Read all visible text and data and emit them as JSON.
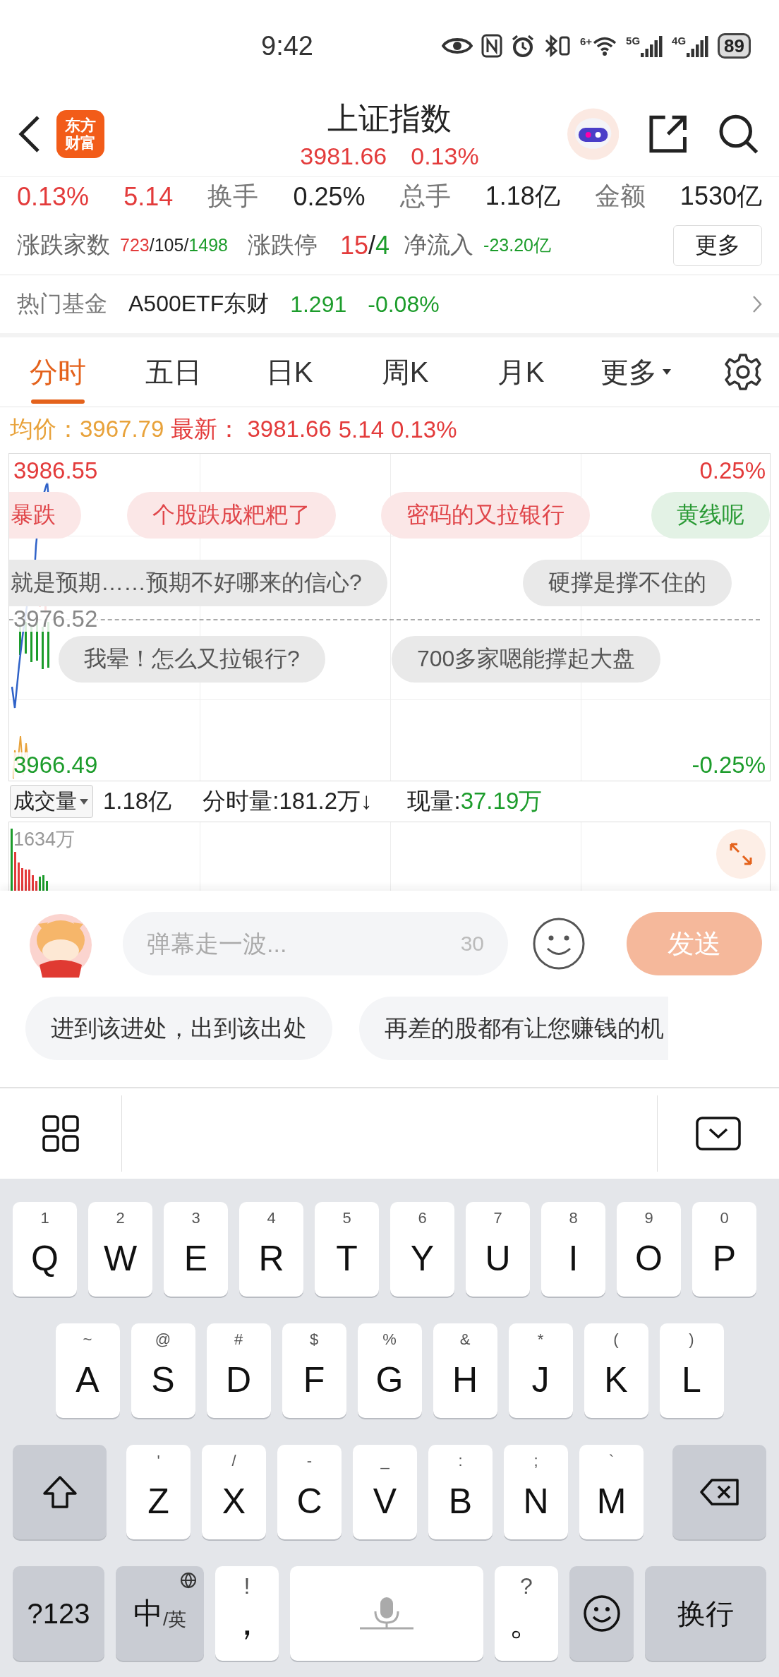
{
  "status_bar": {
    "time": "9:42",
    "wifi_label": "6+",
    "networks": [
      "5G",
      "4G"
    ],
    "battery": "89"
  },
  "header": {
    "logo": [
      "东方",
      "财富"
    ],
    "title": "上证指数",
    "price": "3981.66",
    "change_pct": "0.13%"
  },
  "stats": [
    {
      "kind": "up",
      "text": "0.13%"
    },
    {
      "kind": "up",
      "text": "5.14"
    },
    {
      "kind": "label",
      "text": "换手"
    },
    {
      "kind": "value",
      "text": "0.25%"
    },
    {
      "kind": "label",
      "text": "总手"
    },
    {
      "kind": "value",
      "text": "1.18亿"
    },
    {
      "kind": "label",
      "text": "金额"
    },
    {
      "kind": "value",
      "text": "1530亿"
    }
  ],
  "breadth": {
    "label": "涨跌家数",
    "up": "723",
    "flat": "105",
    "down": "1498",
    "separator": "/"
  },
  "limits": {
    "label": "涨跌停",
    "up": "15",
    "down": "4",
    "separator": "/"
  },
  "net_inflow": {
    "label": "净流入",
    "value": "-23.20亿"
  },
  "more_button": "更多",
  "hot_fund": {
    "label": "热门基金",
    "name": "A500ETF东财",
    "price": "1.291",
    "change": "-0.08%"
  },
  "tabs": [
    {
      "label": "分时",
      "selected": true,
      "kind": "tab"
    },
    {
      "label": "五日",
      "selected": false,
      "kind": "tab"
    },
    {
      "label": "日K",
      "selected": false,
      "kind": "tab"
    },
    {
      "label": "周K",
      "selected": false,
      "kind": "tab"
    },
    {
      "label": "月K",
      "selected": false,
      "kind": "tab"
    },
    {
      "label": "更多",
      "selected": false,
      "kind": "menu"
    }
  ],
  "quote_line": {
    "avg_label": "均价：",
    "avg": "3967.79",
    "latest_label": "最新：",
    "latest": "3981.66",
    "change": "5.14",
    "change_pct": "0.13%"
  },
  "chart": {
    "high": "3986.55",
    "high_pct": "0.25%",
    "mid": "3976.52",
    "low": "3966.49",
    "low_pct": "-0.25%",
    "danmaku": [
      [
        {
          "text": "暴跌",
          "color": "#e0464a"
        },
        {
          "text": "个股跌成粑粑了",
          "color": "#e0464a"
        },
        {
          "text": "密码的又拉银行",
          "color": "#e0464a"
        },
        {
          "text": "黄线呢",
          "color": "#2a9a35"
        }
      ],
      [
        {
          "text": "就是预期……预期不好哪来的信心?",
          "color": "#555555"
        },
        {
          "text": "硬撑是撑不住的",
          "color": "#555555"
        }
      ],
      [
        {
          "text": "我晕！怎么又拉银行?",
          "color": "#555555"
        },
        {
          "text": "700多家嗯能撑起大盘",
          "color": "#555555"
        }
      ]
    ]
  },
  "volume": {
    "selector": "成交量",
    "total": "1.18亿",
    "period": "分时量:181.2万↓",
    "current_label": "现量:",
    "current": "37.19万",
    "max": "1634万"
  },
  "comment": {
    "placeholder": "弹幕走一波...",
    "counter": "30",
    "send": "发送",
    "quick_phrases": [
      "进到该进处，出到该出处",
      "再差的股都有让您赚钱的机"
    ]
  },
  "keyboard": [
    [
      {
        "kind": "char",
        "label": "Q",
        "hint": "1"
      },
      {
        "kind": "char",
        "label": "W",
        "hint": "2"
      },
      {
        "kind": "char",
        "label": "E",
        "hint": "3"
      },
      {
        "kind": "char",
        "label": "R",
        "hint": "4"
      },
      {
        "kind": "char",
        "label": "T",
        "hint": "5"
      },
      {
        "kind": "char",
        "label": "Y",
        "hint": "6"
      },
      {
        "kind": "char",
        "label": "U",
        "hint": "7"
      },
      {
        "kind": "char",
        "label": "I",
        "hint": "8"
      },
      {
        "kind": "char",
        "label": "O",
        "hint": "9"
      },
      {
        "kind": "char",
        "label": "P",
        "hint": "0"
      }
    ],
    [
      {
        "kind": "char",
        "label": "A",
        "hint": "~"
      },
      {
        "kind": "char",
        "label": "S",
        "hint": "@"
      },
      {
        "kind": "char",
        "label": "D",
        "hint": "#"
      },
      {
        "kind": "char",
        "label": "F",
        "hint": "$"
      },
      {
        "kind": "char",
        "label": "G",
        "hint": "%"
      },
      {
        "kind": "char",
        "label": "H",
        "hint": "&"
      },
      {
        "kind": "char",
        "label": "J",
        "hint": "*"
      },
      {
        "kind": "char",
        "label": "K",
        "hint": "("
      },
      {
        "kind": "char",
        "label": "L",
        "hint": ")"
      }
    ],
    [
      {
        "kind": "shift"
      },
      {
        "kind": "char",
        "label": "Z",
        "hint": "'"
      },
      {
        "kind": "char",
        "label": "X",
        "hint": "/"
      },
      {
        "kind": "char",
        "label": "C",
        "hint": "-"
      },
      {
        "kind": "char",
        "label": "V",
        "hint": "_"
      },
      {
        "kind": "char",
        "label": "B",
        "hint": ":"
      },
      {
        "kind": "char",
        "label": "N",
        "hint": ";"
      },
      {
        "kind": "char",
        "label": "M",
        "hint": "`"
      },
      {
        "kind": "backspace"
      }
    ],
    [
      {
        "kind": "mode",
        "label": "?123"
      },
      {
        "kind": "lang",
        "label": "中",
        "sub": "/英"
      },
      {
        "kind": "punct",
        "label": "，",
        "hint": "!"
      },
      {
        "kind": "space"
      },
      {
        "kind": "punct",
        "label": "。",
        "hint": "?"
      },
      {
        "kind": "emoji"
      },
      {
        "kind": "enter",
        "label": "换行"
      }
    ]
  ]
}
